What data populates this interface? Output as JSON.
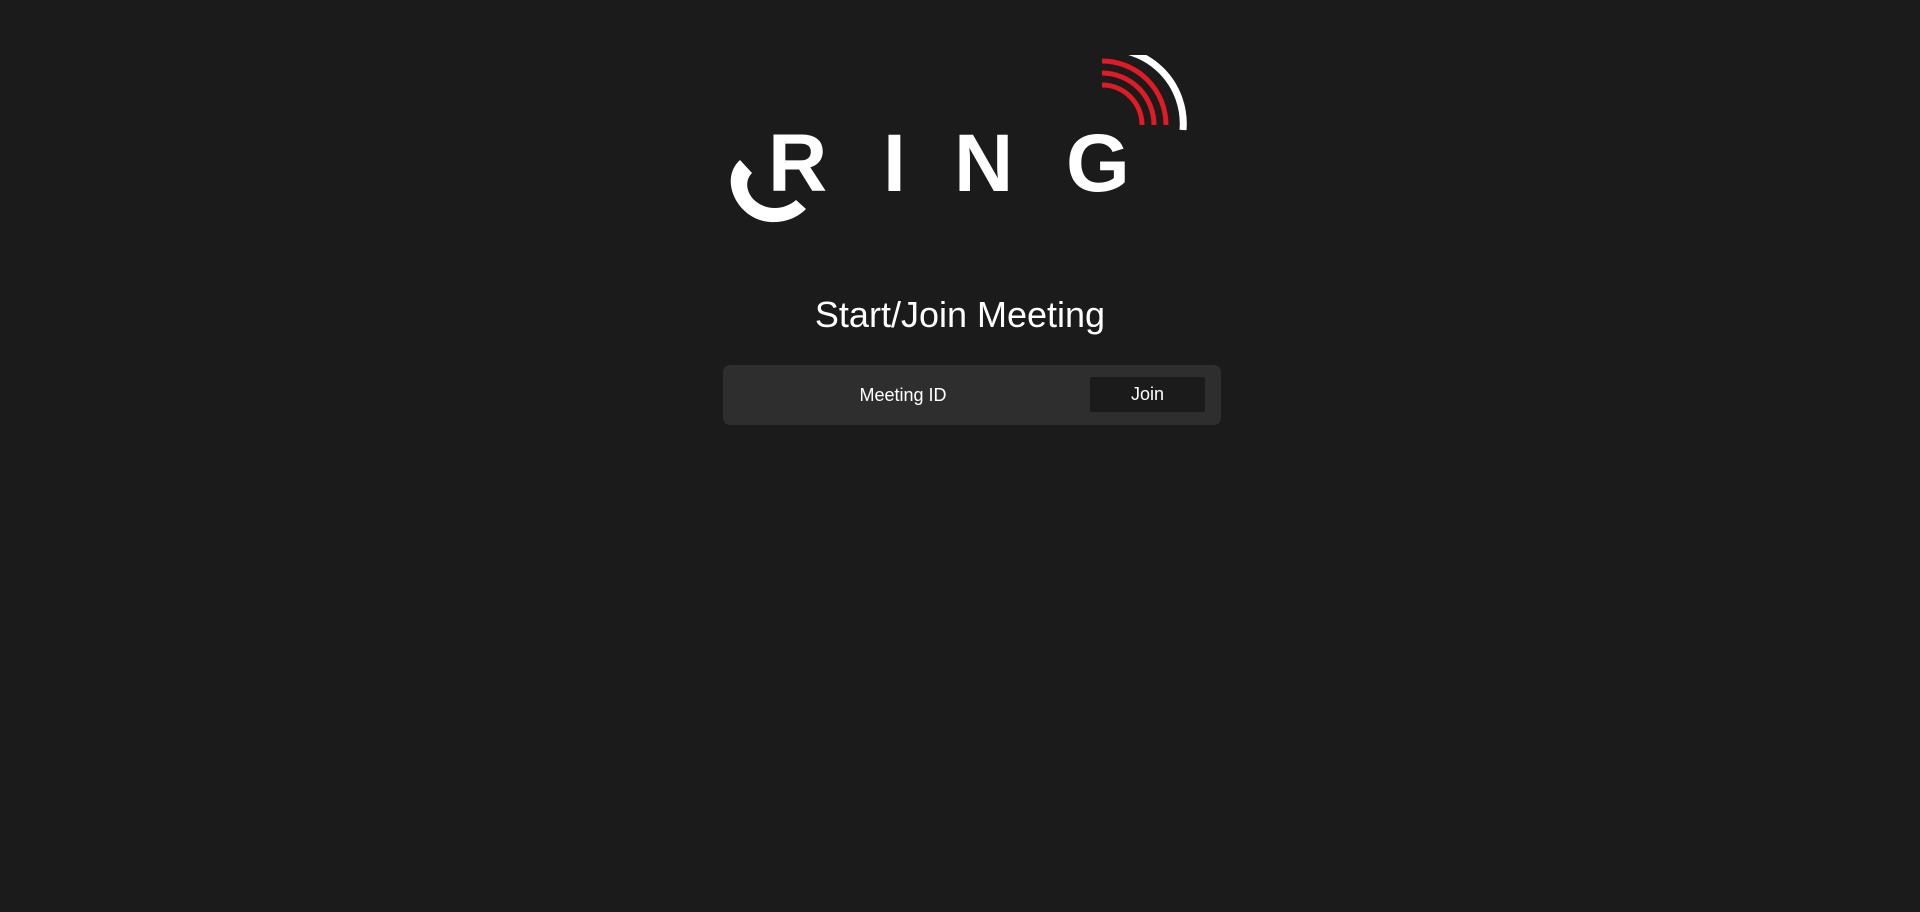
{
  "logo": {
    "text": "RING",
    "letters": [
      "R",
      "I",
      "N",
      "G"
    ],
    "icons": [
      "phone-handset-icon",
      "signal-waves-icon"
    ],
    "colors": {
      "letters": "#ffffff",
      "signal_inner": "#e01b24",
      "signal_outer": "#ffffff"
    }
  },
  "heading": "Start/Join Meeting",
  "join_form": {
    "meeting_id_placeholder": "Meeting ID",
    "meeting_id_value": "",
    "join_label": "Join"
  },
  "colors": {
    "background": "#1b1b1b",
    "panel": "#2e2e2e",
    "button": "#1b1b1b",
    "text": "#ffffff"
  }
}
